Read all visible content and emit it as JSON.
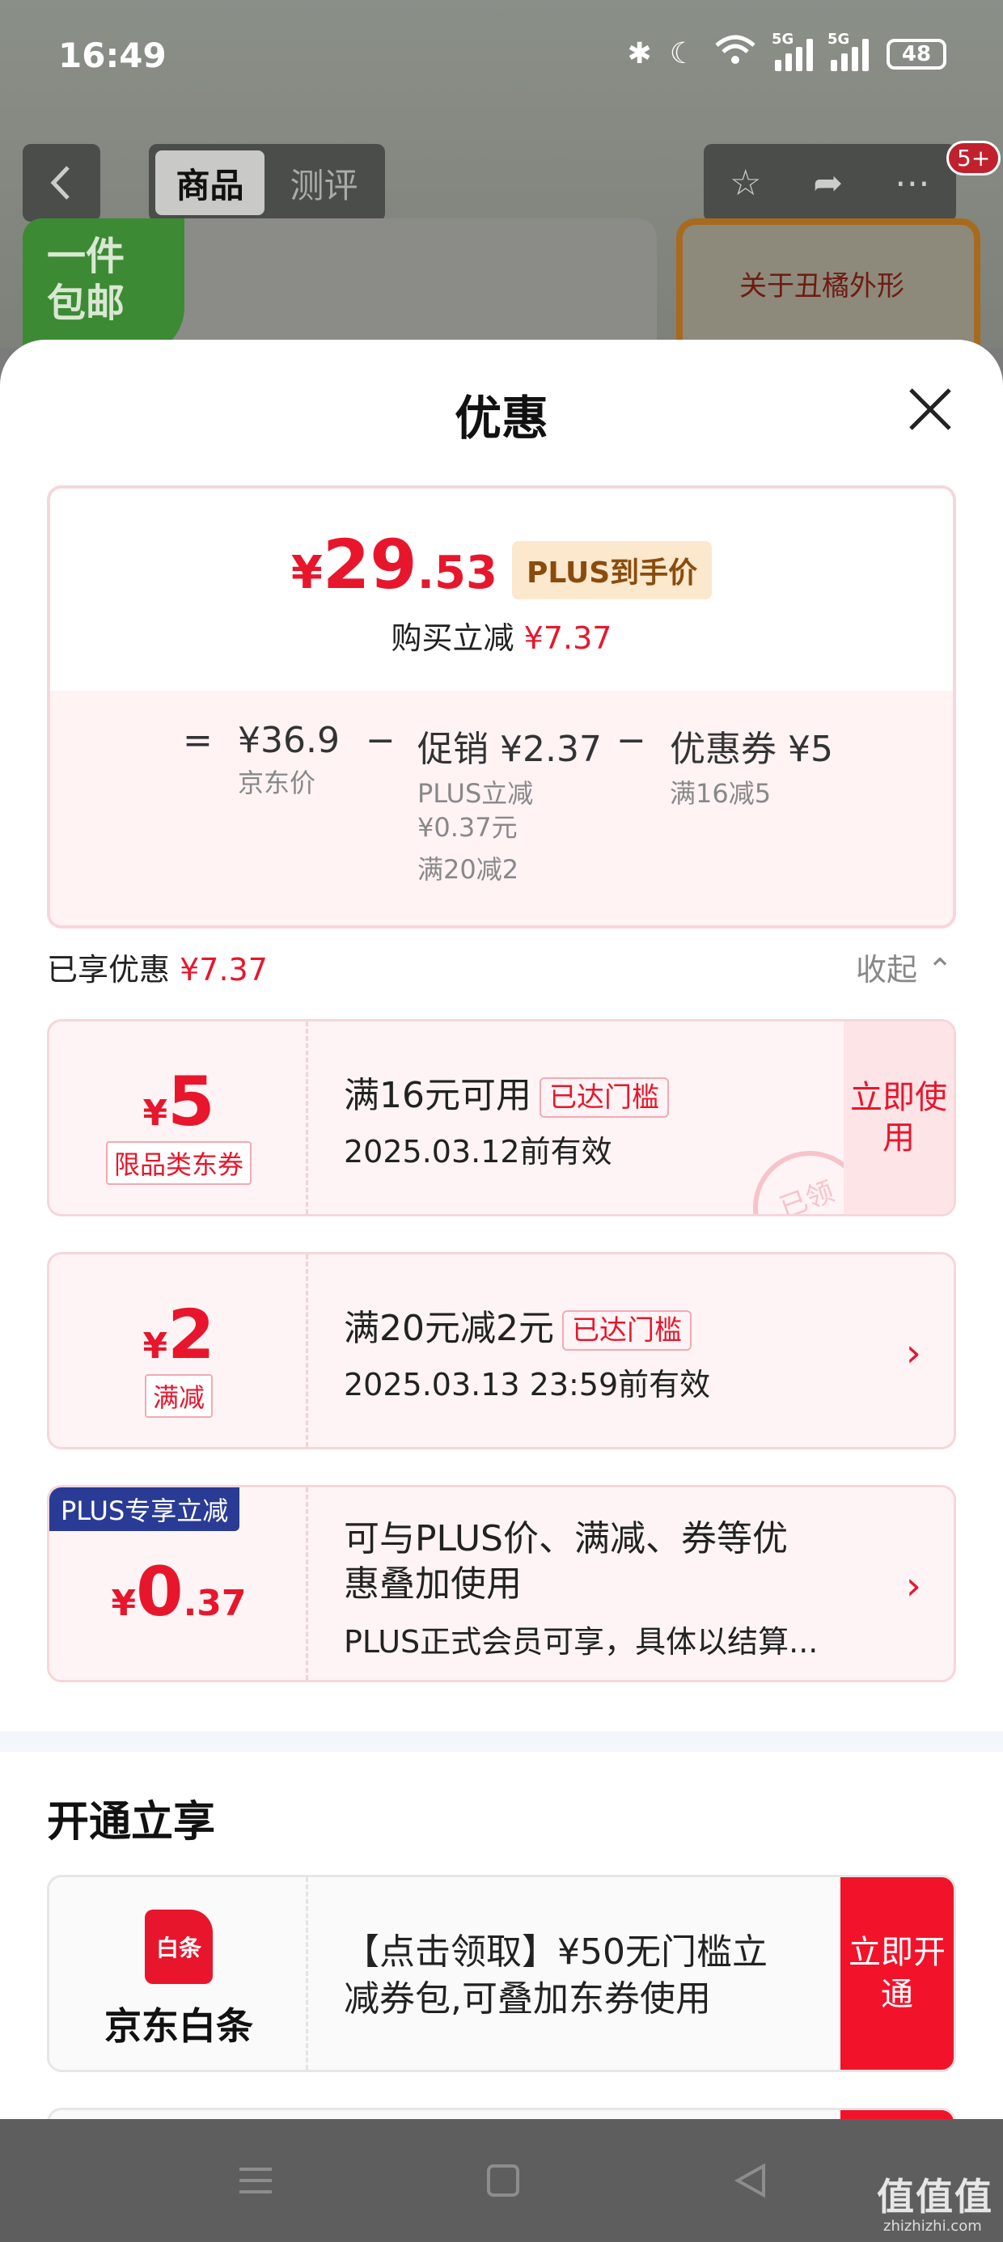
{
  "status_bar": {
    "time": "16:49",
    "network1": "5G",
    "network2": "5G",
    "battery": "48"
  },
  "background_page": {
    "tabs": [
      "商品",
      "测评"
    ],
    "cart_badge": "5+",
    "free_shipping": "一件包邮",
    "shape_card_title": "关于丑橘外形"
  },
  "sheet": {
    "title": "优惠",
    "price": {
      "yen": "¥",
      "integer": "29",
      "decimal": ".53",
      "tag": "PLUS到手价",
      "reduce_label": "购买立减",
      "reduce_amount": "¥7.37",
      "eq": "=",
      "minus": "−",
      "jd_price": "¥36.9",
      "jd_price_label": "京东价",
      "promo": "促销 ¥2.37",
      "promo_sub1": "PLUS立减",
      "promo_sub2": "¥0.37元",
      "promo_sub3": "满20减2",
      "coupon": "优惠券 ¥5",
      "coupon_sub": "满16减5"
    },
    "enjoyed_label": "已享优惠",
    "enjoyed_amount": "¥7.37",
    "collapse_label": "收起",
    "coupons": [
      {
        "yen": "¥",
        "value": "5",
        "kind": "限品类东券",
        "title": "满16元可用",
        "reached": "已达门槛",
        "expire": "2025.03.12前有效",
        "action": "立即使用",
        "stamp": "已领"
      },
      {
        "yen": "¥",
        "value": "2",
        "kind": "满减",
        "title": "满20元减2元",
        "reached": "已达门槛",
        "expire": "2025.03.13 23:59前有效"
      },
      {
        "ribbon": "PLUS专享立减",
        "yen": "¥",
        "value": "0",
        "value_small": ".37",
        "title_line1": "可与PLUS价、满减、券等优",
        "title_line2": "惠叠加使用",
        "note": "PLUS正式会员可享，具体以结算..."
      }
    ],
    "open_section": {
      "title": "开通立享",
      "logo_text": "白条",
      "name": "京东白条",
      "desc_line1": "【点击领取】¥50无门槛立",
      "desc_line2": "减券包,可叠加东券使用",
      "action": "立即开通"
    }
  },
  "watermark": {
    "main": "值值值",
    "sub": "zhizhizhi.com"
  },
  "colors": {
    "accent_red": "#e8162c",
    "plus_blue": "#2a3b96",
    "plus_tag_bg": "#fbe8cd"
  }
}
